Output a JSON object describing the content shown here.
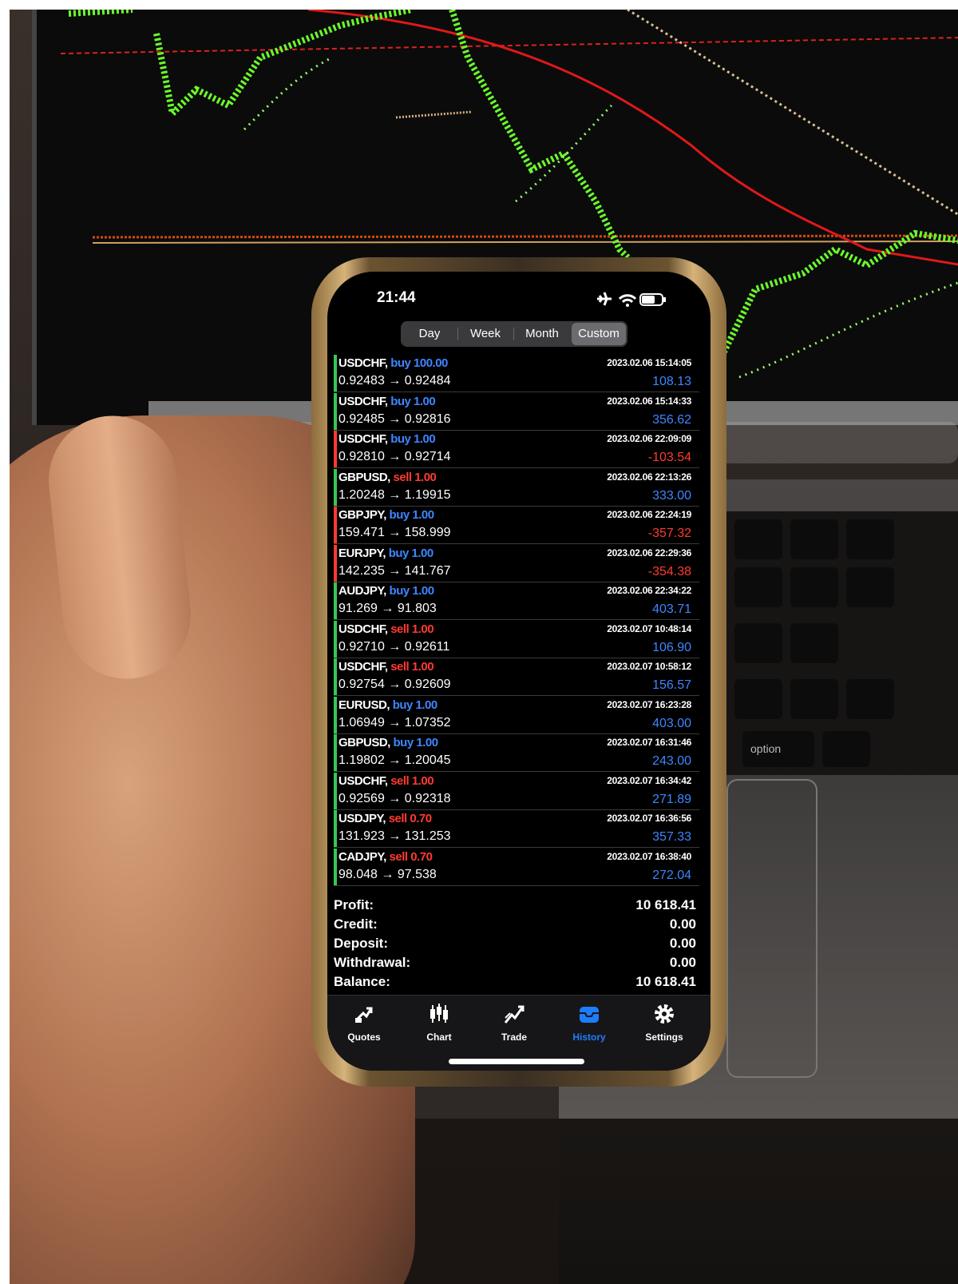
{
  "status_bar": {
    "time": "21:44"
  },
  "period_tabs": [
    {
      "label": "Day",
      "active": false
    },
    {
      "label": "Week",
      "active": false
    },
    {
      "label": "Month",
      "active": false
    },
    {
      "label": "Custom",
      "active": true
    }
  ],
  "colors": {
    "buy": "#3d86ff",
    "sell": "#ff3b30",
    "profit_pos": "#3d86ff",
    "profit_neg": "#ff3b30",
    "bar_pos": "#34c759",
    "bar_neg": "#ff3b30",
    "active_tab": "#1e7dff"
  },
  "trades": [
    {
      "symbol": "USDCHF,",
      "action": "buy 100.00",
      "side": "buy",
      "prices": "0.92483 → 0.92484",
      "time": "2023.02.06 15:14:05",
      "profit": "108.13",
      "positive": true
    },
    {
      "symbol": "USDCHF,",
      "action": "buy 1.00",
      "side": "buy",
      "prices": "0.92485 → 0.92816",
      "time": "2023.02.06 15:14:33",
      "profit": "356.62",
      "positive": true
    },
    {
      "symbol": "USDCHF,",
      "action": "buy 1.00",
      "side": "buy",
      "prices": "0.92810 → 0.92714",
      "time": "2023.02.06 22:09:09",
      "profit": "-103.54",
      "positive": false
    },
    {
      "symbol": "GBPUSD,",
      "action": "sell 1.00",
      "side": "sell",
      "prices": "1.20248 → 1.19915",
      "time": "2023.02.06 22:13:26",
      "profit": "333.00",
      "positive": true
    },
    {
      "symbol": "GBPJPY,",
      "action": "buy 1.00",
      "side": "buy",
      "prices": "159.471 → 158.999",
      "time": "2023.02.06 22:24:19",
      "profit": "-357.32",
      "positive": false
    },
    {
      "symbol": "EURJPY,",
      "action": "buy 1.00",
      "side": "buy",
      "prices": "142.235 → 141.767",
      "time": "2023.02.06 22:29:36",
      "profit": "-354.38",
      "positive": false
    },
    {
      "symbol": "AUDJPY,",
      "action": "buy 1.00",
      "side": "buy",
      "prices": "91.269 → 91.803",
      "time": "2023.02.06 22:34:22",
      "profit": "403.71",
      "positive": true
    },
    {
      "symbol": "USDCHF,",
      "action": "sell 1.00",
      "side": "sell",
      "prices": "0.92710 → 0.92611",
      "time": "2023.02.07 10:48:14",
      "profit": "106.90",
      "positive": true
    },
    {
      "symbol": "USDCHF,",
      "action": "sell 1.00",
      "side": "sell",
      "prices": "0.92754 → 0.92609",
      "time": "2023.02.07 10:58:12",
      "profit": "156.57",
      "positive": true
    },
    {
      "symbol": "EURUSD,",
      "action": "buy 1.00",
      "side": "buy",
      "prices": "1.06949 → 1.07352",
      "time": "2023.02.07 16:23:28",
      "profit": "403.00",
      "positive": true
    },
    {
      "symbol": "GBPUSD,",
      "action": "buy 1.00",
      "side": "buy",
      "prices": "1.19802 → 1.20045",
      "time": "2023.02.07 16:31:46",
      "profit": "243.00",
      "positive": true
    },
    {
      "symbol": "USDCHF,",
      "action": "sell 1.00",
      "side": "sell",
      "prices": "0.92569 → 0.92318",
      "time": "2023.02.07 16:34:42",
      "profit": "271.89",
      "positive": true
    },
    {
      "symbol": "USDJPY,",
      "action": "sell 0.70",
      "side": "sell",
      "prices": "131.923 → 131.253",
      "time": "2023.02.07 16:36:56",
      "profit": "357.33",
      "positive": true
    },
    {
      "symbol": "CADJPY,",
      "action": "sell 0.70",
      "side": "sell",
      "prices": "98.048 → 97.538",
      "time": "2023.02.07 16:38:40",
      "profit": "272.04",
      "positive": true
    }
  ],
  "summary": [
    {
      "label": "Profit:",
      "value": "10 618.41"
    },
    {
      "label": "Credit:",
      "value": "0.00"
    },
    {
      "label": "Deposit:",
      "value": "0.00"
    },
    {
      "label": "Withdrawal:",
      "value": "0.00"
    },
    {
      "label": "Balance:",
      "value": "10 618.41"
    }
  ],
  "tabs": [
    {
      "label": "Quotes",
      "icon": "quotes-icon",
      "active": false
    },
    {
      "label": "Chart",
      "icon": "chart-icon",
      "active": false
    },
    {
      "label": "Trade",
      "icon": "trade-icon",
      "active": false
    },
    {
      "label": "History",
      "icon": "history-icon",
      "active": true
    },
    {
      "label": "Settings",
      "icon": "settings-icon",
      "active": false
    }
  ],
  "keyboard": {
    "option_key": "option"
  }
}
